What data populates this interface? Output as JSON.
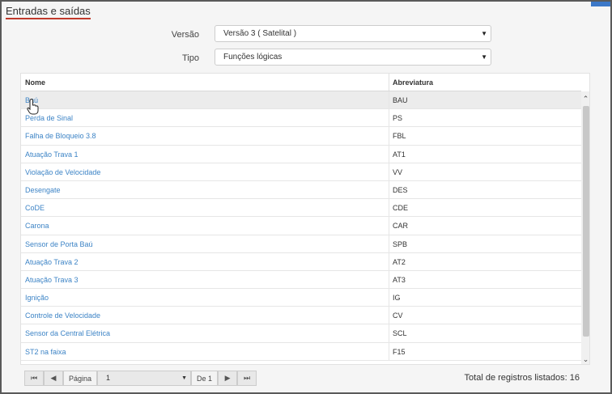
{
  "page": {
    "title": "Entradas e saídas"
  },
  "filters": {
    "version_label": "Versão",
    "version_value": "Versão 3 ( Satelital )",
    "type_label": "Tipo",
    "type_value": "Funções lógicas"
  },
  "grid": {
    "columns": [
      "Nome",
      "Abreviatura"
    ],
    "rows": [
      {
        "nome": "Baú",
        "abrev": "BAU"
      },
      {
        "nome": "Perda de Sinal",
        "abrev": "PS"
      },
      {
        "nome": "Falha de Bloqueio 3.8",
        "abrev": "FBL"
      },
      {
        "nome": "Atuação Trava 1",
        "abrev": "AT1"
      },
      {
        "nome": "Violação de Velocidade",
        "abrev": "VV"
      },
      {
        "nome": "Desengate",
        "abrev": "DES"
      },
      {
        "nome": "CoDE",
        "abrev": "CDE"
      },
      {
        "nome": "Carona",
        "abrev": "CAR"
      },
      {
        "nome": "Sensor de Porta Baú",
        "abrev": "SPB"
      },
      {
        "nome": "Atuação Trava 2",
        "abrev": "AT2"
      },
      {
        "nome": "Atuação Trava 3",
        "abrev": "AT3"
      },
      {
        "nome": "Ignição",
        "abrev": "IG"
      },
      {
        "nome": "Controle de Velocidade",
        "abrev": "CV"
      },
      {
        "nome": "Sensor da Central Elétrica",
        "abrev": "SCL"
      },
      {
        "nome": "ST2 na faixa",
        "abrev": "F15"
      }
    ]
  },
  "pager": {
    "page_label": "Página",
    "page_value": "1",
    "of_label": "De 1",
    "total_label": "Total de registros listados: 16"
  },
  "icons": {
    "first": "first-page-icon",
    "prev": "previous-page-icon",
    "next": "next-page-icon",
    "last": "last-page-icon"
  },
  "colors": {
    "link": "#3d84c6",
    "title_underline": "#c0392b"
  }
}
